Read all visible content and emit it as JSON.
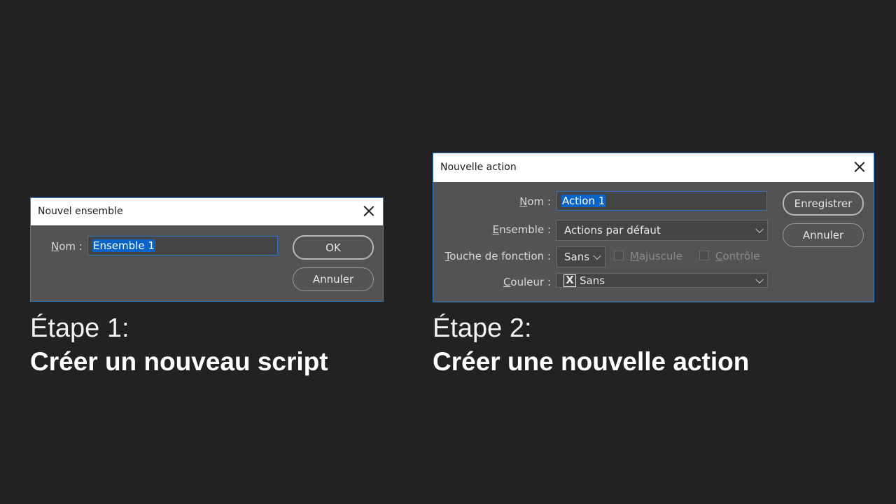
{
  "dialog1": {
    "title": "Nouvel ensemble",
    "name_label": "Nom :",
    "name_label_accel": "N",
    "name_label_rest": "om :",
    "name_value": "Ensemble 1",
    "ok_label": "OK",
    "cancel_label": "Annuler"
  },
  "dialog2": {
    "title": "Nouvelle action",
    "name_label_accel": "N",
    "name_label_rest": "om :",
    "name_value": "Action 1",
    "set_label_accel": "E",
    "set_label_rest": "nsemble :",
    "set_value": "Actions par défaut",
    "fkey_label_accel": "T",
    "fkey_label_rest": "ouche de fonction :",
    "fkey_value": "Sans",
    "shift_accel": "M",
    "shift_rest": "ajuscule",
    "ctrl_accel": "C",
    "ctrl_rest": "ontrôle",
    "color_label_accel": "C",
    "color_label_rest": "ouleur :",
    "color_icon": "X",
    "color_value": "Sans",
    "record_label": "Enregistrer",
    "cancel_label": "Annuler"
  },
  "captions": {
    "step1": "Étape 1:",
    "step1_title": "Créer un nouveau script",
    "step2": "Étape 2:",
    "step2_title": "Créer une nouvelle action"
  },
  "colors": {
    "background": "#222222",
    "dialog_body": "#535353",
    "accent": "#2f7fd3",
    "selection": "#0a64c8"
  }
}
